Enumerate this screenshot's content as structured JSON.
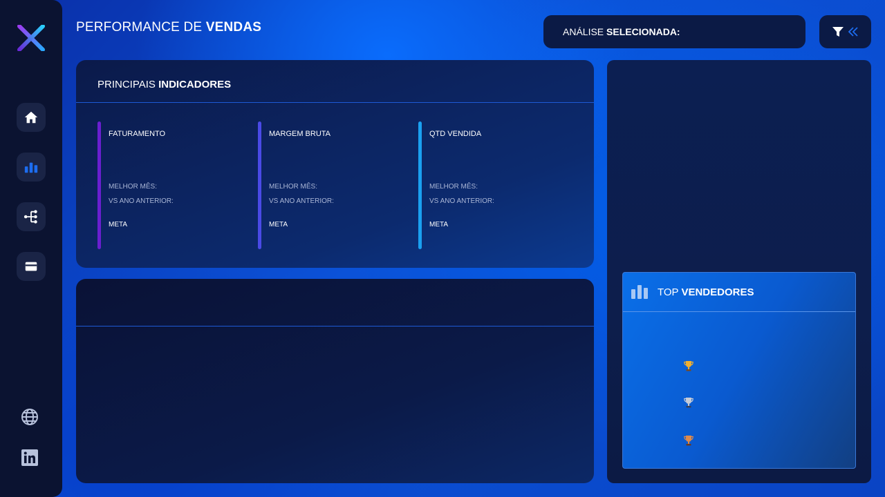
{
  "header": {
    "title_light": "PERFORMANCE DE ",
    "title_bold": "VENDAS",
    "analise_light": "ANÁLISE ",
    "analise_bold": "SELECIONADA:"
  },
  "sidebar": {
    "items": [
      {
        "icon": "home-icon"
      },
      {
        "icon": "bar-chart-icon"
      },
      {
        "icon": "tree-icon"
      },
      {
        "icon": "card-icon"
      }
    ],
    "footer": [
      {
        "icon": "globe-icon"
      },
      {
        "icon": "linkedin-icon"
      }
    ]
  },
  "kpi_panel": {
    "title_light": "PRINCIPAIS ",
    "title_bold": "INDICADORES",
    "cards": [
      {
        "title": "FATURAMENTO",
        "best_label": "MELHOR MÊS:",
        "vs_label": "VS ANO ANTERIOR:",
        "meta_label": "META",
        "accent": "#6a1fd0"
      },
      {
        "title": "MARGEM BRUTA",
        "best_label": "MELHOR MÊS:",
        "vs_label": "VS ANO ANTERIOR:",
        "meta_label": "META",
        "accent": "#4a4ae6"
      },
      {
        "title": "QTD VENDIDA",
        "best_label": "MELHOR MÊS:",
        "vs_label": "VS ANO ANTERIOR:",
        "meta_label": "META",
        "accent": "#1aa0f0"
      }
    ]
  },
  "top_vendedores": {
    "title_light": "TOP ",
    "title_bold": "VENDEDORES",
    "trophies": [
      "gold-trophy-icon",
      "silver-trophy-icon",
      "bronze-trophy-icon"
    ]
  },
  "colors": {
    "sidebar_bg": "#0b1331",
    "accent_blue": "#1d6df0",
    "gold": "#f0b030",
    "silver": "#c8ccd6",
    "bronze": "#e08a4a"
  }
}
